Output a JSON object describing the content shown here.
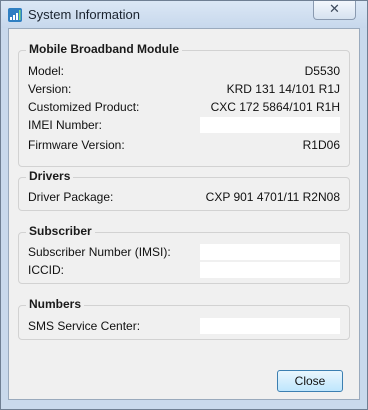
{
  "window": {
    "title": "System Information",
    "close_glyph": "✕",
    "icon": "signal-bars-icon"
  },
  "groups": {
    "module": {
      "title": "Mobile Broadband Module",
      "rows": [
        {
          "label": "Model:",
          "value": "D5530"
        },
        {
          "label": "Version:",
          "value": "KRD 131 14/101 R1J"
        },
        {
          "label": "Customized Product:",
          "value": "CXC 172 5864/101 R1H"
        },
        {
          "label": "IMEI Number:",
          "value": ""
        },
        {
          "label": "Firmware Version:",
          "value": "R1D06"
        }
      ]
    },
    "drivers": {
      "title": "Drivers",
      "rows": [
        {
          "label": "Driver Package:",
          "value": "CXP 901 4701/11 R2N08"
        }
      ]
    },
    "subscriber": {
      "title": "Subscriber",
      "rows": [
        {
          "label": "Subscriber Number (IMSI):",
          "value": ""
        },
        {
          "label": "ICCID:",
          "value": ""
        }
      ]
    },
    "numbers": {
      "title": "Numbers",
      "rows": [
        {
          "label": "SMS Service Center:",
          "value": ""
        }
      ]
    }
  },
  "footer": {
    "close_label": "Close"
  },
  "colors": {
    "frame": "#c9d9ec",
    "client": "#f0f0f0",
    "button_border": "#3c7fb1",
    "icon_green": "#3aa33a"
  }
}
